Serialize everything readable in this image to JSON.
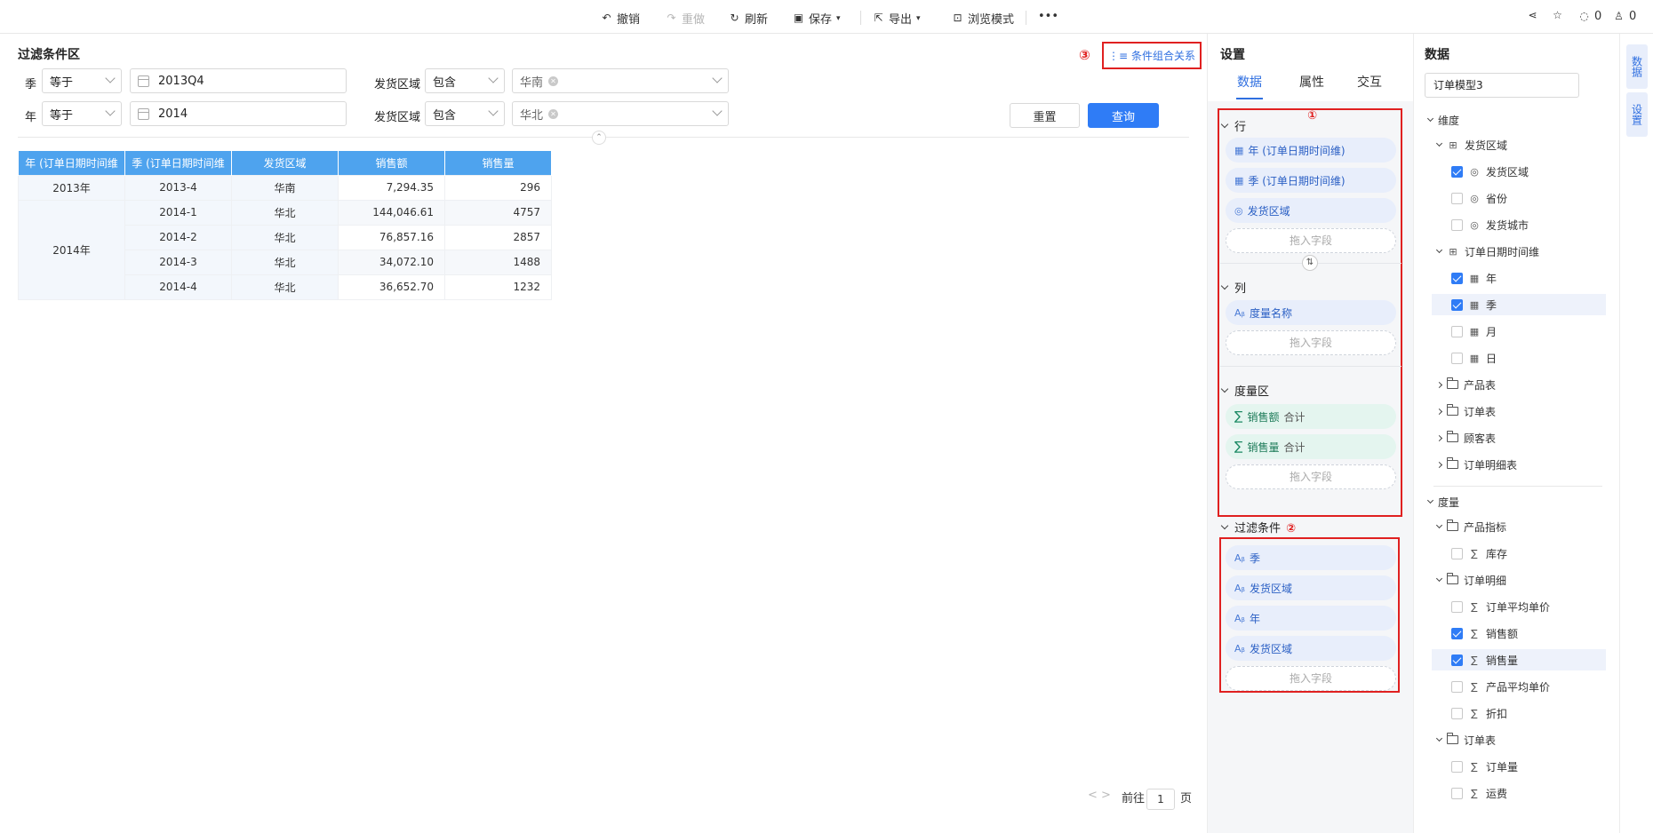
{
  "toolbar": {
    "undo": "撤销",
    "redo": "重做",
    "refresh": "刷新",
    "save": "保存",
    "export": "导出",
    "browse": "浏览模式",
    "more": "•••",
    "comments": "0",
    "likes": "0"
  },
  "filter": {
    "title": "过滤条件区",
    "rows": [
      {
        "label": "季",
        "op": "等于",
        "value": "2013Q4",
        "label2": "发货区域",
        "op2": "包含",
        "tag": "华南"
      },
      {
        "label": "年",
        "op": "等于",
        "value": "2014",
        "label2": "发货区域",
        "op2": "包含",
        "tag": "华北"
      }
    ],
    "reset": "重置",
    "query": "查询",
    "combo": "条件组合关系",
    "combo_mark": "③"
  },
  "table": {
    "headers": [
      "年 (订单日期时间维",
      "季 (订单日期时间维",
      "发货区域",
      "销售额",
      "销售量"
    ],
    "rows": [
      {
        "year": "2013年",
        "quarter": "2013-4",
        "region": "华南",
        "sales": "7,294.35",
        "qty": "296"
      },
      {
        "year": "2014年",
        "quarter": "2014-1",
        "region": "华北",
        "sales": "144,046.61",
        "qty": "4757"
      },
      {
        "year": "",
        "quarter": "2014-2",
        "region": "华北",
        "sales": "76,857.16",
        "qty": "2857"
      },
      {
        "year": "",
        "quarter": "2014-3",
        "region": "华北",
        "sales": "34,072.10",
        "qty": "1488"
      },
      {
        "year": "",
        "quarter": "2014-4",
        "region": "华北",
        "sales": "36,652.70",
        "qty": "1232"
      }
    ]
  },
  "pager": {
    "prev_next": "<  >",
    "goto": "前往",
    "page": "1",
    "unit": "页"
  },
  "settings": {
    "title": "设置",
    "tabs": [
      "数据",
      "属性",
      "交互"
    ],
    "marks": [
      "①",
      "②"
    ],
    "row_section": "行",
    "row_fields": [
      "年 (订单日期时间维)",
      "季 (订单日期时间维)",
      "发货区域"
    ],
    "col_section": "列",
    "col_fields": [
      "度量名称"
    ],
    "measure_section": "度量区",
    "measures": [
      {
        "name": "销售额",
        "agg": "合计"
      },
      {
        "name": "销售量",
        "agg": "合计"
      }
    ],
    "filter_section": "过滤条件",
    "filter_fields": [
      "季",
      "发货区域",
      "年",
      "发货区域"
    ],
    "drop_hint": "拖入字段"
  },
  "data_panel": {
    "title": "数据",
    "model": "订单模型3",
    "dim_title": "维度",
    "measure_title": "度量",
    "dims": [
      {
        "label": "发货区域",
        "level": 1,
        "kind": "hier"
      },
      {
        "label": "发货区域",
        "level": 2,
        "kind": "geo",
        "checked": true
      },
      {
        "label": "省份",
        "level": 2,
        "kind": "geo",
        "checked": false
      },
      {
        "label": "发货城市",
        "level": 2,
        "kind": "geo",
        "checked": false
      },
      {
        "label": "订单日期时间维",
        "level": 1,
        "kind": "hier"
      },
      {
        "label": "年",
        "level": 2,
        "kind": "date",
        "checked": true
      },
      {
        "label": "季",
        "level": 2,
        "kind": "date",
        "checked": true,
        "hl": true
      },
      {
        "label": "月",
        "level": 2,
        "kind": "date",
        "checked": false
      },
      {
        "label": "日",
        "level": 2,
        "kind": "date",
        "checked": false
      },
      {
        "label": "产品表",
        "level": 1,
        "kind": "folder"
      },
      {
        "label": "订单表",
        "level": 1,
        "kind": "folder"
      },
      {
        "label": "顾客表",
        "level": 1,
        "kind": "folder"
      },
      {
        "label": "订单明细表",
        "level": 1,
        "kind": "folder"
      }
    ],
    "measures": [
      {
        "label": "产品指标",
        "level": 1,
        "kind": "open"
      },
      {
        "label": "库存",
        "level": 2,
        "kind": "sum",
        "checked": false
      },
      {
        "label": "订单明细",
        "level": 1,
        "kind": "open"
      },
      {
        "label": "订单平均单价",
        "level": 2,
        "kind": "sum",
        "checked": false
      },
      {
        "label": "销售额",
        "level": 2,
        "kind": "sum",
        "checked": true
      },
      {
        "label": "销售量",
        "level": 2,
        "kind": "sum",
        "checked": true,
        "hl": true
      },
      {
        "label": "产品平均单价",
        "level": 2,
        "kind": "sum",
        "checked": false
      },
      {
        "label": "折扣",
        "level": 2,
        "kind": "sum",
        "checked": false
      },
      {
        "label": "订单表",
        "level": 1,
        "kind": "open"
      },
      {
        "label": "订单量",
        "level": 2,
        "kind": "sum",
        "checked": false
      },
      {
        "label": "运费",
        "level": 2,
        "kind": "sum",
        "checked": false
      }
    ]
  },
  "rail": {
    "tabs": [
      "数据",
      "设置"
    ]
  },
  "colors": {
    "accent": "#2f7cf6",
    "header": "#4ea3ee",
    "annotation": "#e02020"
  }
}
